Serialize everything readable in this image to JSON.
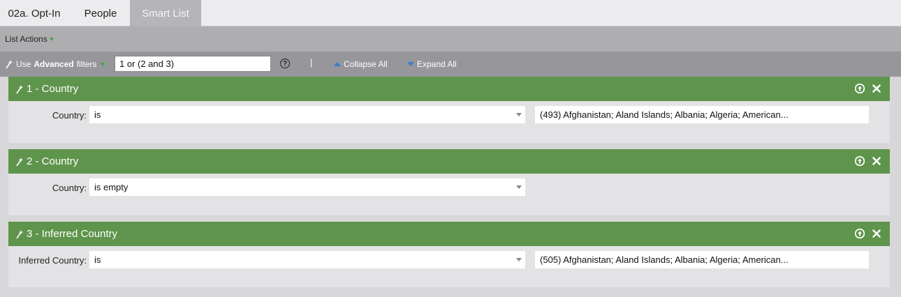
{
  "tabs": [
    {
      "label": "02a. Opt-In"
    },
    {
      "label": "People"
    },
    {
      "label": "Smart List"
    }
  ],
  "toolbar": {
    "list_actions": "List Actions",
    "use_label": "Use",
    "advanced_label": "Advanced",
    "filters_label": "filters",
    "logic_value": "1 or (2 and 3)",
    "help": "?",
    "separator": "|",
    "collapse_all": "Collapse All",
    "expand_all": "Expand All"
  },
  "filters": [
    {
      "title": "1 - Country",
      "label": "Country:",
      "operator": "is",
      "value": "(493) Afghanistan; Aland Islands; Albania; Algeria; American..."
    },
    {
      "title": "2 - Country",
      "label": "Country:",
      "operator": "is empty",
      "value": ""
    },
    {
      "title": "3 - Inferred Country",
      "label": "Inferred Country:",
      "operator": "is",
      "value": "(505) Afghanistan; Aland Islands; Albania; Algeria; American..."
    }
  ],
  "colors": {
    "filter_header": "#5e944b",
    "accent_green": "#3ca83c",
    "accent_blue": "#3b7ec9"
  }
}
